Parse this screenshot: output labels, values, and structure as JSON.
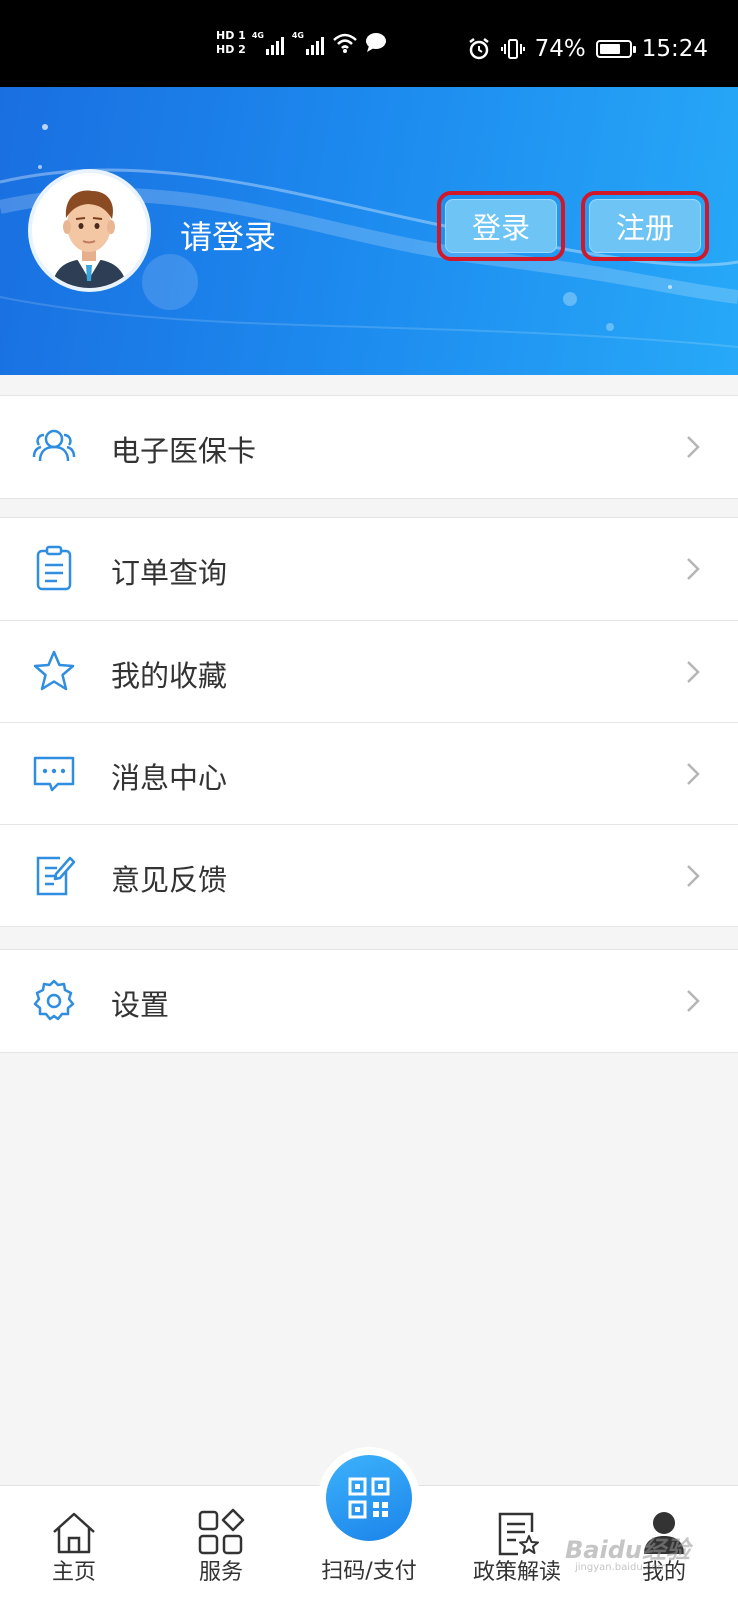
{
  "status_bar": {
    "hd1": "HD 1",
    "hd2": "HD 2",
    "net1": "4G",
    "net2": "4G",
    "battery": "74%",
    "battery_level": 0.74,
    "time": "15:24"
  },
  "header": {
    "prompt": "请登录",
    "login_label": "登录",
    "register_label": "注册"
  },
  "menu": {
    "medical_card": "电子医保卡",
    "orders": "订单查询",
    "favorites": "我的收藏",
    "messages": "消息中心",
    "feedback": "意见反馈",
    "settings": "设置"
  },
  "bottom_nav": {
    "home": "主页",
    "services": "服务",
    "scan_pay": "扫码/支付",
    "policy": "政策解读",
    "mine": "我的"
  },
  "watermark": {
    "text": "Baidu经验",
    "sub": "jingyan.baidu.com"
  },
  "colors": {
    "accent": "#2196f3",
    "icon_blue": "#2f8ee0",
    "highlight_border": "#d0182a"
  }
}
